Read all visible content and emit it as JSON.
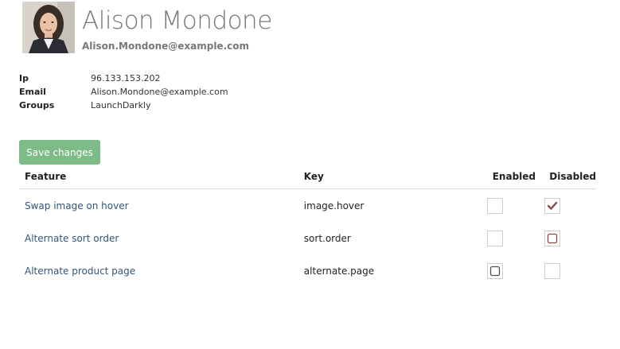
{
  "user": {
    "name": "Alison Mondone",
    "email": "Alison.Mondone@example.com",
    "avatar_icon": "user-photo"
  },
  "info": [
    {
      "label": "Ip",
      "value": "96.133.153.202"
    },
    {
      "label": "Email",
      "value": "Alison.Mondone@example.com"
    },
    {
      "label": "Groups",
      "value": "LaunchDarkly"
    }
  ],
  "actions": {
    "save_label": "Save changes",
    "save_color": "#7dbb87"
  },
  "table": {
    "headers": {
      "feature": "Feature",
      "key": "Key",
      "enabled": "Enabled",
      "disabled": "Disabled"
    },
    "rows": [
      {
        "feature": "Swap image on hover",
        "key": "image.hover",
        "enabled": "unchecked",
        "disabled": "checked"
      },
      {
        "feature": "Alternate sort order",
        "key": "sort.order",
        "enabled": "unchecked",
        "disabled": "focused"
      },
      {
        "feature": "Alternate product page",
        "key": "alternate.page",
        "enabled": "focused",
        "disabled": "unchecked"
      }
    ]
  },
  "colors": {
    "link": "#33557a",
    "check_mark": "#8b4a4a",
    "disabled_focus": "#8b4a4a",
    "enabled_focus": "#3f5f3f"
  }
}
